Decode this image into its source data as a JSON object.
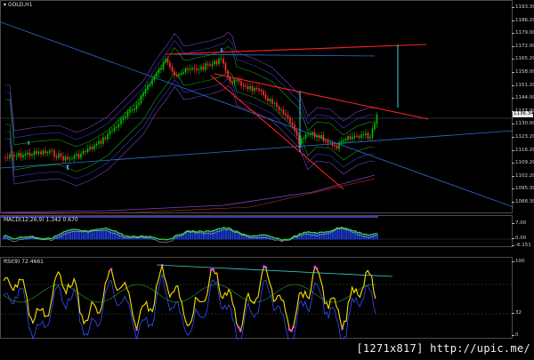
{
  "chart": {
    "symbol_label": "GOLD,H1",
    "main_axis_ticks": [
      "1193.30",
      "1186.20",
      "1179.00",
      "1172.00",
      "1165.20",
      "1158.00",
      "1151.20",
      "1144.00",
      "1137.00",
      "1130.00",
      "1123.20",
      "1116.20",
      "1109.20",
      "1102.20",
      "1095.30",
      "1088.30"
    ],
    "current_price": "1136.34",
    "macd_label": "MACD(12,26,9) 1.342 0.670",
    "macd_axis_ticks": [
      "7.00",
      "0.00",
      "-6.151"
    ],
    "rsi_label": "RSI(9) 72.4661",
    "rsi_axis_ticks": [
      "100",
      "32",
      "0"
    ],
    "colors": {
      "candle_up": "#00c000",
      "candle_down": "#ff3030",
      "trendline_red": "#ff2020",
      "trendline_blue": "#2a6fd6",
      "cyan": "#40d0d0",
      "macd_hist": "#1f3fe0",
      "macd_line": "#30e030",
      "rsi_line": "#ffe000",
      "rsi_dots": "#ff40ff"
    }
  },
  "footer": {
    "text": "[1271x817] http://upic.me/"
  }
}
